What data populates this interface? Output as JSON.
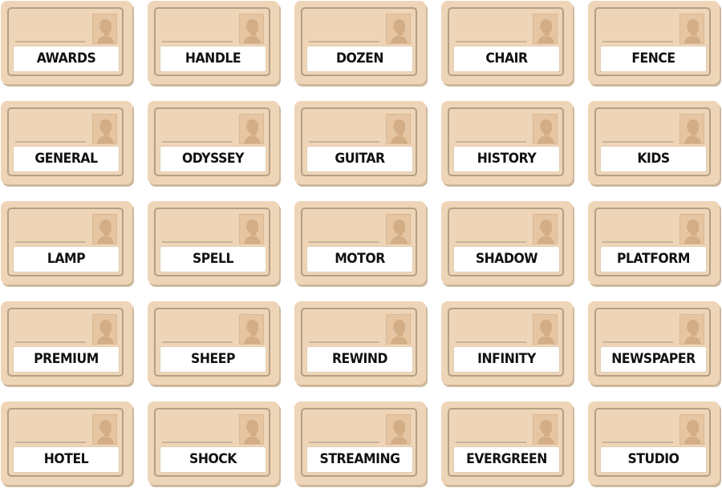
{
  "board": {
    "colors": {
      "card_face": "#efd5b7",
      "card_shadow": "#cdb89c",
      "frame_border": "#b39f84",
      "photo_fill": "#e6c6a2",
      "silhouette": "#d2ad85",
      "word_plate": "#ffffff",
      "word_text": "#111111"
    },
    "icon": "portrait-silhouette-icon",
    "rows": [
      [
        "AWARDS",
        "HANDLE",
        "DOZEN",
        "CHAIR",
        "FENCE"
      ],
      [
        "GENERAL",
        "ODYSSEY",
        "GUITAR",
        "HISTORY",
        "KIDS"
      ],
      [
        "LAMP",
        "SPELL",
        "MOTOR",
        "SHADOW",
        "PLATFORM"
      ],
      [
        "PREMIUM",
        "SHEEP",
        "REWIND",
        "INFINITY",
        "NEWSPAPER"
      ],
      [
        "HOTEL",
        "SHOCK",
        "STREAMING",
        "EVERGREEN",
        "STUDIO"
      ]
    ]
  }
}
